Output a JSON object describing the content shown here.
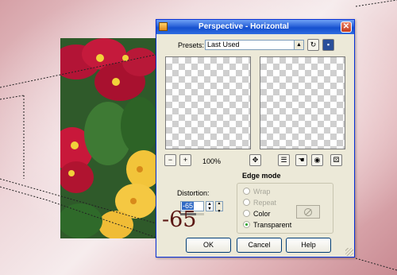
{
  "dialog": {
    "title": "Perspective - Horizontal",
    "presets_label": "Presets:",
    "presets_value": "Last Used",
    "zoom_level": "100%",
    "edge_mode_title": "Edge mode",
    "edge_modes": [
      {
        "label": "Wrap",
        "selected": false,
        "enabled": false
      },
      {
        "label": "Repeat",
        "selected": false,
        "enabled": false
      },
      {
        "label": "Color",
        "selected": false,
        "enabled": true
      },
      {
        "label": "Transparent",
        "selected": true,
        "enabled": true
      }
    ],
    "distortion_label": "Distortion:",
    "distortion_value": "-65",
    "distortion_level": -0.65,
    "buttons": {
      "ok": "OK",
      "cancel": "Cancel",
      "help": "Help"
    }
  },
  "annotation": {
    "value": "-65",
    "color": "#5b1714"
  },
  "colors": {
    "titlebar": "#2a62d8",
    "dialog_bg": "#ece9d8",
    "background": "#e9c8cc"
  },
  "icons": [
    "app-icon",
    "close-icon",
    "reset-icon",
    "save-preset-icon",
    "zoom-out-icon",
    "zoom-in-icon",
    "move-icon",
    "preview-toggle-icon",
    "hand-icon",
    "eye-icon",
    "randomize-icon",
    "no-color-icon"
  ]
}
